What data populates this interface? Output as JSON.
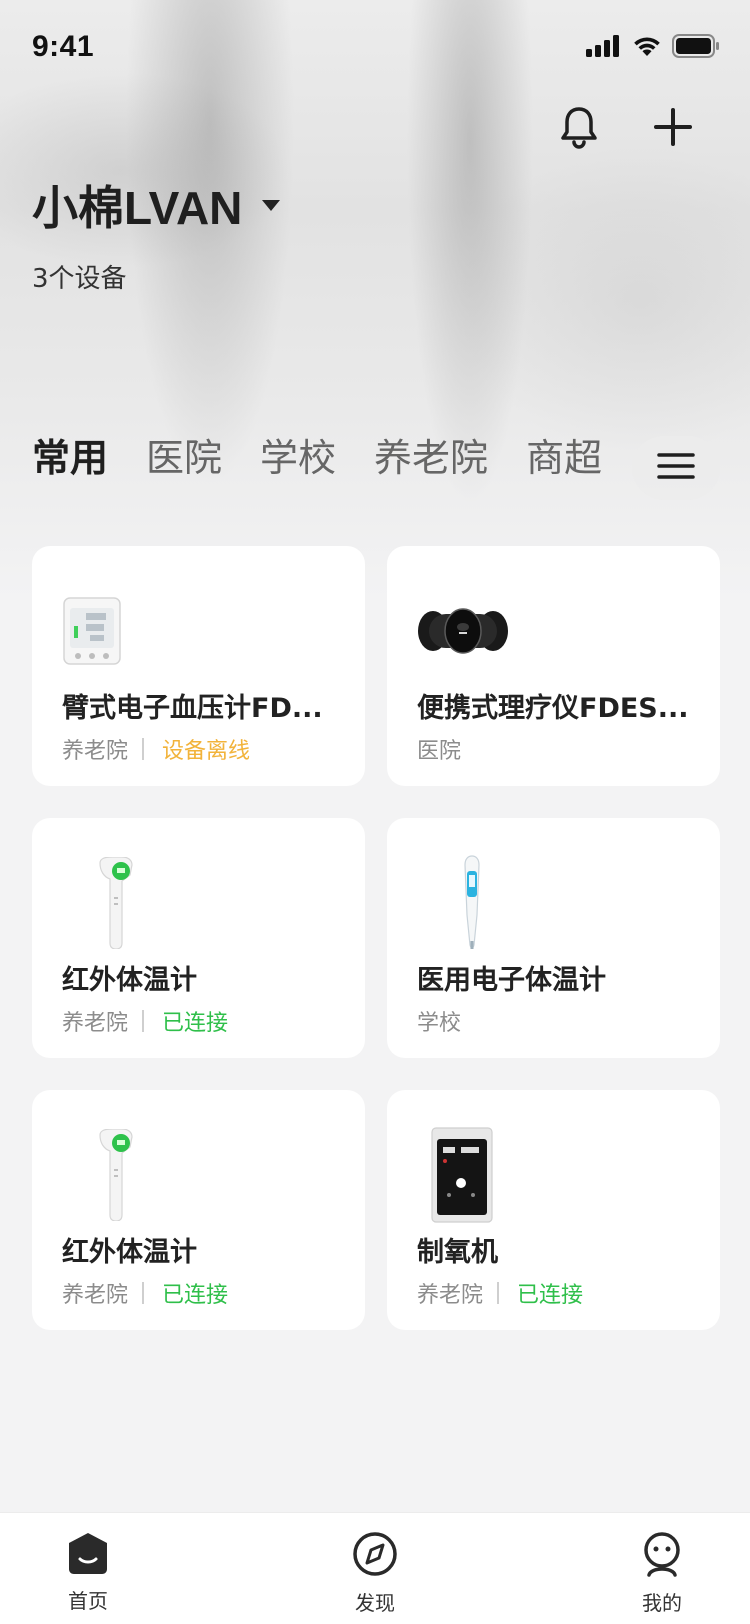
{
  "status_bar": {
    "time": "9:41"
  },
  "header": {
    "account_name": "小棉LVAN",
    "device_count": "3个设备"
  },
  "tabs": [
    {
      "label": "常用",
      "active": true
    },
    {
      "label": "医院",
      "active": false
    },
    {
      "label": "学校",
      "active": false
    },
    {
      "label": "养老院",
      "active": false
    },
    {
      "label": "商超",
      "active": false
    }
  ],
  "devices": [
    {
      "name": "臂式电子血压计FD...",
      "location": "养老院",
      "status": "设备离线",
      "status_type": "offline",
      "icon": "blood-pressure-monitor-icon"
    },
    {
      "name": "便携式理疗仪FDES...",
      "location": "医院",
      "status": "",
      "status_type": "none",
      "icon": "physio-device-icon"
    },
    {
      "name": "红外体温计",
      "location": "养老院",
      "status": "已连接",
      "status_type": "online",
      "icon": "infrared-thermometer-icon"
    },
    {
      "name": "医用电子体温计",
      "location": "学校",
      "status": "",
      "status_type": "none",
      "icon": "digital-thermometer-icon"
    },
    {
      "name": "红外体温计",
      "location": "养老院",
      "status": "已连接",
      "status_type": "online",
      "icon": "infrared-thermometer-icon"
    },
    {
      "name": "制氧机",
      "location": "养老院",
      "status": "已连接",
      "status_type": "online",
      "icon": "oxygen-concentrator-icon"
    }
  ],
  "bottom_nav": [
    {
      "label": "首页",
      "icon": "home-icon",
      "active": true
    },
    {
      "label": "发现",
      "icon": "compass-icon",
      "active": false
    },
    {
      "label": "我的",
      "icon": "profile-icon",
      "active": false
    }
  ],
  "colors": {
    "offline": "#f2b33a",
    "online": "#2fbf4a",
    "background": "#f3f3f4"
  }
}
